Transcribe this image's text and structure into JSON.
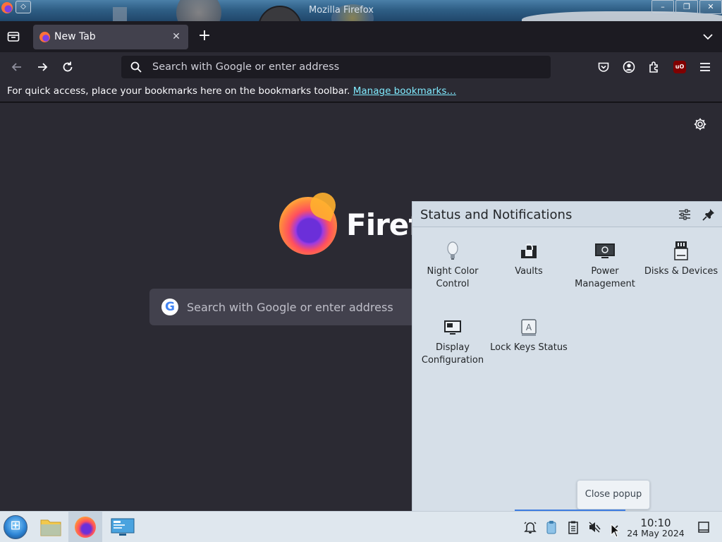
{
  "window": {
    "title": "Mozilla Firefox",
    "buttons": [
      "–",
      "❐",
      "✕"
    ]
  },
  "tabs": [
    {
      "label": "New Tab",
      "active": true
    }
  ],
  "navbar": {
    "url_placeholder": "Search with Google or enter address"
  },
  "bookmarks_bar": {
    "text": "For quick access, place your bookmarks here on the bookmarks toolbar.",
    "link": "Manage bookmarks…"
  },
  "newtab_page": {
    "wordmark": "Firefox",
    "search_placeholder": "Search with Google or enter address",
    "search_engine_icon": "G"
  },
  "popup": {
    "title": "Status and Notifications",
    "applets": [
      {
        "label": "Night Color Control",
        "icon": "lightbulb-icon"
      },
      {
        "label": "Vaults",
        "icon": "lock-icon"
      },
      {
        "label": "Power Management",
        "icon": "monitor-icon"
      },
      {
        "label": "Disks & Devices",
        "icon": "drive-icon"
      },
      {
        "label": "Display Configuration",
        "icon": "display-icon"
      },
      {
        "label": "Lock Keys Status",
        "icon": "keyboard-key-icon"
      }
    ]
  },
  "tooltip": "Close popup",
  "taskbar": {
    "time": "10:10",
    "date": "24 May 2024"
  },
  "colors": {
    "firefox_bg": "#2b2a33",
    "link": "#80ebff",
    "popup_bg": "#d6dfe8",
    "highlight": "#3d7ce0"
  }
}
